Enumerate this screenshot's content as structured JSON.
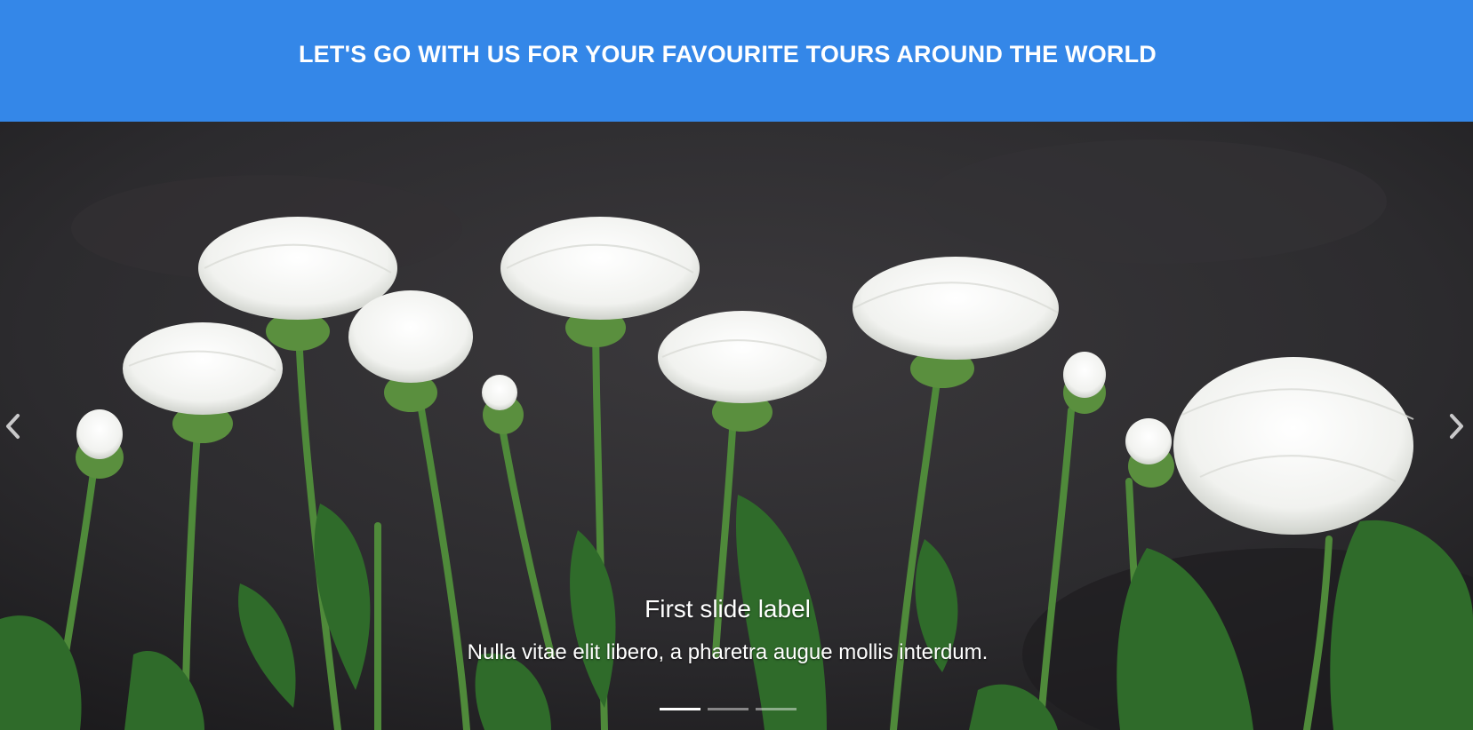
{
  "banner": {
    "title": "LET'S GO WITH US FOR YOUR FAVOURITE TOURS AROUND THE WORLD",
    "background_color": "#3487e8"
  },
  "carousel": {
    "prev_icon": "chevron-left-icon",
    "next_icon": "chevron-right-icon",
    "active_slide": 1,
    "slide_count": 3,
    "slides": [
      {
        "label": "First slide label",
        "text": "Nulla vitae elit libero, a pharetra augue mollis interdum."
      }
    ]
  }
}
